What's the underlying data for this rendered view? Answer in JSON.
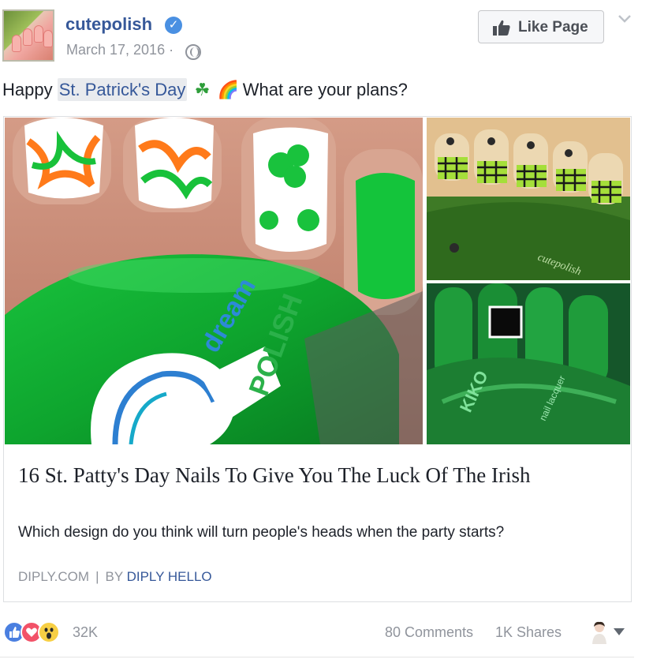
{
  "header": {
    "page_name": "cutepolish",
    "date": "March 17, 2016",
    "date_sep": "·",
    "like_page_label": "Like Page"
  },
  "message": {
    "before": "Happy ",
    "hashtag": "St. Patrick's Day",
    "emoji_1": "☘",
    "emoji_2": "🌈",
    "after": " What are your plans?"
  },
  "link_card": {
    "title": "16 St. Patty's Day Nails To Give You The Luck Of The Irish",
    "description": "Which design do you think will turn people's heads when the party starts?",
    "source": "DIPLY.COM",
    "separator": "|",
    "by_label": "BY ",
    "author": "DIPLY HELLO",
    "image_text": {
      "polish_brand_1": "dream",
      "polish_brand_2": "POLISH",
      "watermark": "cutepolish",
      "bottle_brand": "KIKO",
      "bottle_sub": "nail lacquer"
    }
  },
  "footer": {
    "reaction_count": "32K",
    "comments": "80 Comments",
    "shares": "1K Shares"
  },
  "colors": {
    "link_blue": "#365899",
    "meta_gray": "#90949c",
    "text": "#1d2129",
    "verified_blue": "#4a90e2",
    "like_blue": "#4a7fe0",
    "love_red": "#f25268",
    "wow_yellow": "#f7cf44"
  },
  "icons": [
    "verified-badge-icon",
    "globe-icon",
    "thumbs-up-icon",
    "chevron-down-icon",
    "like-reaction-icon",
    "love-reaction-icon",
    "wow-reaction-icon",
    "caret-down-icon"
  ]
}
